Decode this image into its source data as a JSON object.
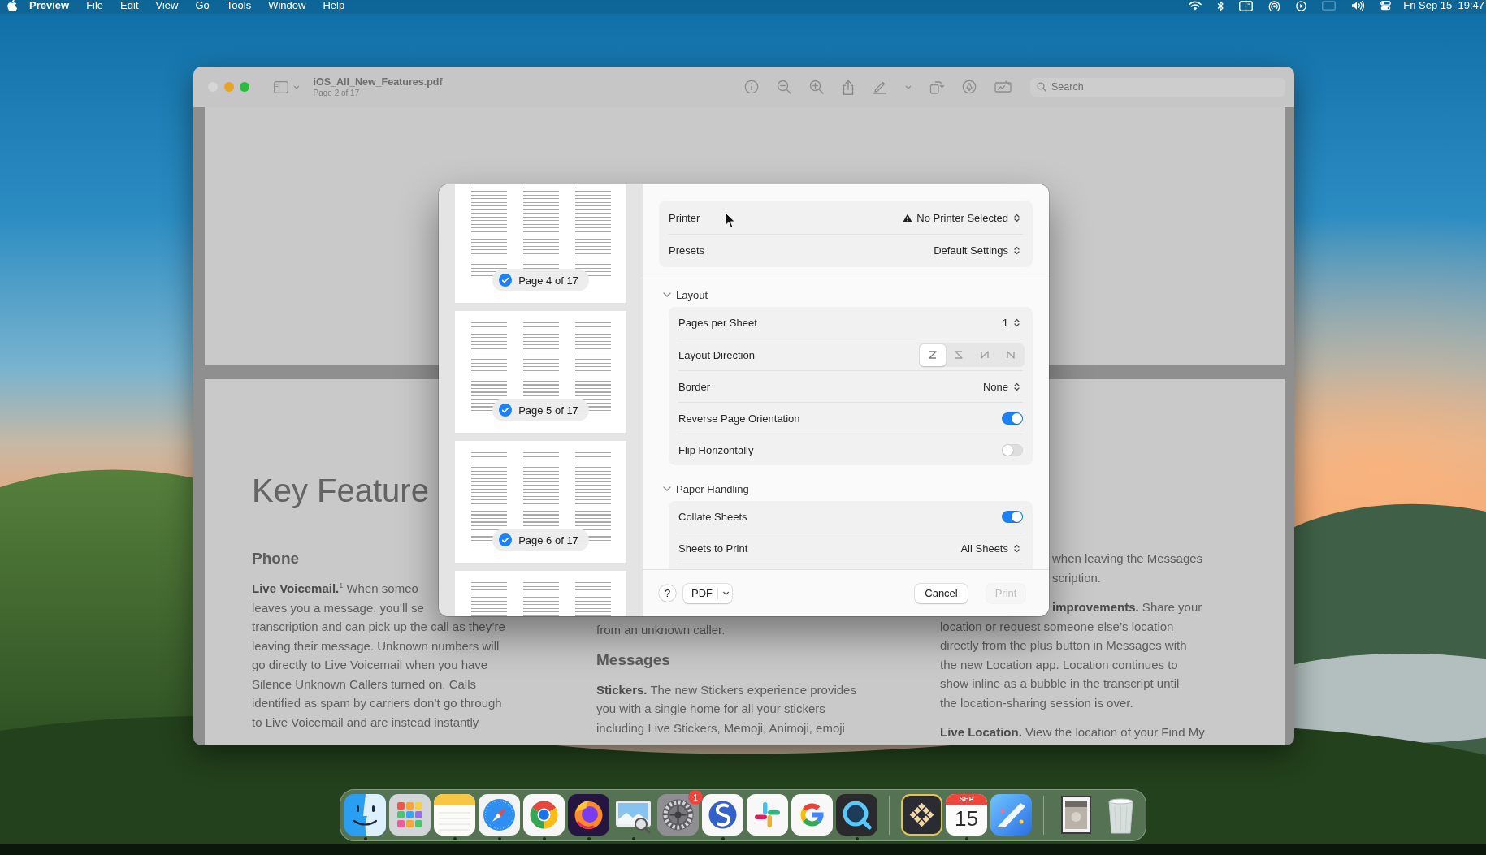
{
  "menu_bar": {
    "app_name": "Preview",
    "menus": [
      "File",
      "Edit",
      "View",
      "Go",
      "Tools",
      "Window",
      "Help"
    ],
    "clock": "Fri Sep 15  19:47"
  },
  "window": {
    "title": "iOS_All_New_Features.pdf",
    "subtitle": "Page 2 of 17",
    "search": {
      "placeholder": "Search"
    },
    "document": {
      "title": "Key Feature",
      "columns": [
        {
          "blocks": [
            {
              "kind": "heading",
              "text": "Phone"
            },
            {
              "kind": "paragraph",
              "lines": [
                {
                  "kind": "line",
                  "text": "**Live Voicemail.**$^{1}$ When someo"
                },
                {
                  "kind": "line",
                  "text": "leaves you a message, you’ll se"
                },
                {
                  "kind": "line",
                  "text": "transcription and can pick up the call as they’re"
                },
                {
                  "kind": "line",
                  "text": "leaving their message. Unknown numbers will"
                },
                {
                  "kind": "line",
                  "text": "go directly to Live Voicemail when you have"
                },
                {
                  "kind": "line",
                  "text": "Silence Unknown Callers turned on. Calls"
                },
                {
                  "kind": "line",
                  "text": "identified as spam by carriers don’t go through"
                },
                {
                  "kind": "line",
                  "text": "to Live Voicemail and are instead instantly"
                }
              ]
            }
          ]
        },
        {
          "blocks": [
            {
              "kind": "paragraph",
              "lines": [
                {
                  "kind": "line",
                  "text": "from an unknown caller."
                }
              ]
            },
            {
              "kind": "heading",
              "text": "Messages"
            },
            {
              "kind": "paragraph",
              "lines": [
                {
                  "kind": "line",
                  "text": "**Stickers.** The new Stickers experience provides"
                },
                {
                  "kind": "line",
                  "text": "you with a single home for all your stickers"
                },
                {
                  "kind": "line",
                  "text": "including Live Stickers, Memoji, Animoji, emoji"
                }
              ]
            }
          ]
        },
        {
          "blocks": [
            {
              "kind": "paragraph",
              "lines": [
                {
                  "kind": "tail",
                  "text": "when leaving the Messages"
                },
                {
                  "kind": "tail",
                  "text": "scription."
                }
              ]
            },
            {
              "kind": "paragraph",
              "lines": [
                {
                  "kind": "tail",
                  "text": "**improvements.** Share your"
                },
                {
                  "kind": "line",
                  "text": "location or request someone else’s location"
                },
                {
                  "kind": "line",
                  "text": "directly from the plus button in Messages with"
                },
                {
                  "kind": "line",
                  "text": "the new Location app. Location continues to"
                },
                {
                  "kind": "line",
                  "text": "show inline as a bubble in the transcript until"
                },
                {
                  "kind": "line",
                  "text": "the location-sharing session is over."
                }
              ]
            },
            {
              "kind": "paragraph",
              "lines": [
                {
                  "kind": "line",
                  "text": "**Live Location.** View the location of your Find My"
                }
              ]
            }
          ]
        }
      ]
    }
  },
  "print_dialog": {
    "pages": [
      {
        "label": "Page 4 of 17",
        "checked": true
      },
      {
        "label": "Page 5 of 17",
        "checked": true
      },
      {
        "label": "Page 6 of 17",
        "checked": true
      }
    ],
    "more_pages_below": true,
    "general": [
      {
        "label": "Printer",
        "value": "No Printer Selected",
        "warning": true
      },
      {
        "label": "Presets",
        "value": "Default Settings"
      }
    ],
    "sections": [
      {
        "title": "Layout",
        "expanded": true,
        "rows": [
          {
            "kind": "stepper",
            "label": "Pages per Sheet",
            "value": "1"
          },
          {
            "kind": "segments",
            "label": "Layout Direction",
            "options": [
              {
                "selected": true
              },
              {
                "selected": false
              },
              {
                "selected": false
              },
              {
                "selected": false
              }
            ]
          },
          {
            "kind": "stepper",
            "label": "Border",
            "value": "None"
          },
          {
            "kind": "toggle",
            "label": "Reverse Page Orientation",
            "on": true
          },
          {
            "kind": "toggle",
            "label": "Flip Horizontally",
            "on": false
          }
        ]
      },
      {
        "title": "Paper Handling",
        "expanded": true,
        "rows": [
          {
            "kind": "toggle",
            "label": "Collate Sheets",
            "on": true
          },
          {
            "kind": "stepper",
            "label": "Sheets to Print",
            "value": "All Sheets"
          }
        ]
      }
    ],
    "footer": {
      "help": "?",
      "pdf": "PDF",
      "cancel": "Cancel",
      "print": {
        "label": "Print",
        "disabled": true
      }
    }
  },
  "dock": {
    "groups": [
      {
        "items": [
          {
            "running": true
          },
          {
            "running": false
          },
          {
            "running": true
          },
          {
            "running": true
          },
          {
            "running": true
          },
          {
            "running": true
          },
          {
            "running": true
          },
          {
            "running": false,
            "badge": "1"
          },
          {
            "running": true
          },
          {
            "running": false
          },
          {
            "running": false
          },
          {
            "running": true
          }
        ]
      },
      {
        "items": [
          {
            "running": false
          },
          {
            "running": true,
            "month": "SEP",
            "day": "15"
          },
          {
            "running": false
          }
        ]
      },
      {
        "items": [
          {
            "running": false
          },
          {
            "running": false
          }
        ]
      }
    ]
  }
}
